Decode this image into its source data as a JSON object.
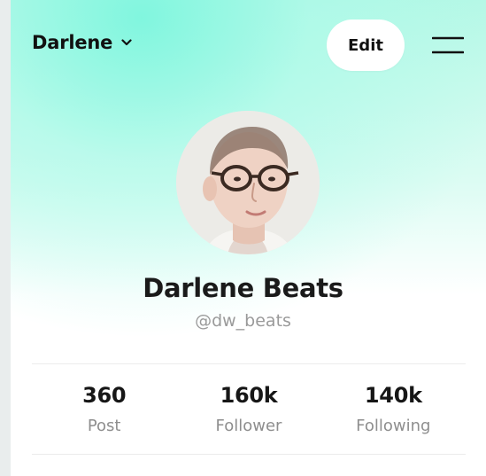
{
  "header": {
    "account_name": "Darlene",
    "edit_label": "Edit"
  },
  "profile": {
    "name": "Darlene Beats",
    "handle": "@dw_beats"
  },
  "stats": [
    {
      "value": "360",
      "label": "Post"
    },
    {
      "value": "160k",
      "label": "Follower"
    },
    {
      "value": "140k",
      "label": "Following"
    }
  ],
  "icons": {
    "account_dropdown": "chevron-down-icon",
    "menu": "menu-icon"
  },
  "colors": {
    "gradient_accent": "#9ef7e0",
    "primary_text": "#111111",
    "secondary_text": "#9a9a9a",
    "button_bg": "#ffffff"
  }
}
